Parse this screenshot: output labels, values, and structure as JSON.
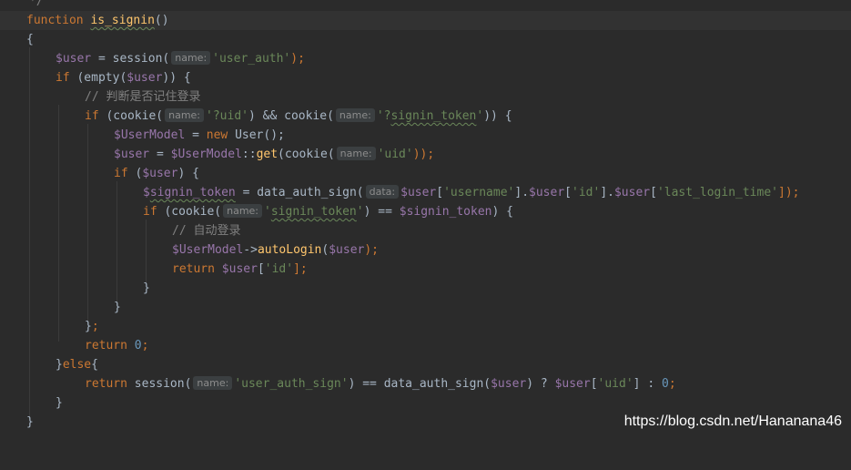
{
  "editor": {
    "lines": [
      [
        "cmt",
        "  */"
      ],
      [
        "kw",
        "function "
      ],
      [
        "plain",
        "{"
      ],
      [
        "var",
        "$user"
      ],
      [
        "kw",
        "if "
      ],
      [
        "cmt",
        "// 判断是否记住登录"
      ],
      [
        "kw",
        "if "
      ],
      [
        "var",
        "$UserModel"
      ],
      [
        "var",
        "$user"
      ],
      [
        "kw",
        "if "
      ],
      [
        "var",
        "$signin_token"
      ],
      [
        "kw",
        "if "
      ],
      [
        "cmt",
        "// 自动登录"
      ],
      [
        "var",
        "$UserModel"
      ],
      [
        "kw",
        "return "
      ],
      [
        "plain",
        "}"
      ],
      [
        "plain",
        "}"
      ],
      [
        "plain",
        "};"
      ],
      [
        "kw",
        "return "
      ],
      [
        "plain",
        "}else{"
      ],
      [
        "kw",
        "return "
      ],
      [
        "plain",
        "}"
      ],
      [
        "plain",
        "}"
      ]
    ],
    "tokens": {
      "comment_close": "*/",
      "function_kw": "function",
      "function_name": "is_signin",
      "function_parens": "()",
      "open_brace": "{",
      "close_brace": "}",
      "user_var": "$user",
      "eq": " = ",
      "session": "session(",
      "hint_name": "name:",
      "hint_data": "data:",
      "str_user_auth": "'user_auth'",
      "semicolon_close": ");",
      "if_kw": "if",
      "empty_open": " (empty(",
      "close_paren_brace": ")) {",
      "comment_remember": "// 判断是否记住登录",
      "cookie_open": " (cookie(",
      "str_q_uid": "'?uid'",
      "and_cookie": ") && cookie(",
      "str_q_signin_pre": "'?",
      "str_signin_token_word": "signin_token",
      "str_quote": "'",
      "close_two_brace": ")) {",
      "usermodel_var": "$UserModel",
      "new_kw": "new",
      "user_class": " User();",
      "static_get_sep": "::",
      "get_fn": "get",
      "cookie_call": "(cookie(",
      "str_uid": "'uid'",
      "close_two_semi": "));",
      "if_user_open": " (",
      "close_brace_open": ") {",
      "signin_token_var_prefix": "$",
      "signin_token_var_word": "signin_token",
      "data_auth_sign": "data_auth_sign(",
      "bracket_open": "[",
      "str_username": "'username'",
      "bracket_dot": "].",
      "str_id": "'id'",
      "str_last_login": "'last_login_time'",
      "bracket_close_semi": "]);",
      "cookie_plain": " (cookie(",
      "str_signin_token_open": "'",
      "eqeq": ") == ",
      "comment_auto": "// 自动登录",
      "arrow": "->",
      "auto_login_fn": "autoLogin",
      "paren_open": "(",
      "paren_close_semi": ");",
      "return_kw": "return",
      "bracket_close_semi2": "];",
      "brace_semi": "};",
      "zero": "0",
      "semi": ";",
      "else_line": "}else{",
      "str_user_auth_sign": "'user_auth_sign'",
      "ternary_q": ") ? ",
      "ternary_colon": "] : ",
      "space": " "
    }
  },
  "watermark": "https://blog.csdn.net/Hananana46"
}
